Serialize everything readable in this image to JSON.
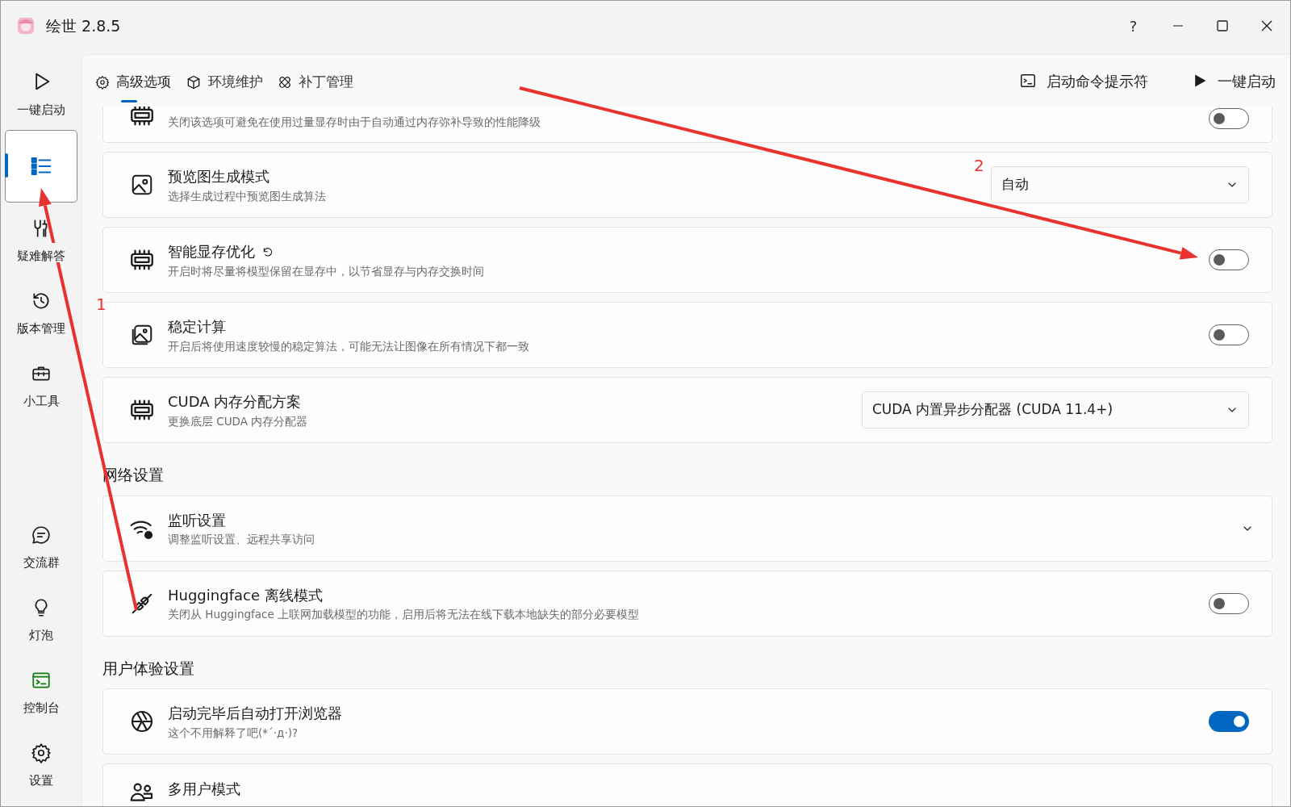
{
  "window": {
    "title": "绘世 2.8.5",
    "controls": [
      "?"
    ]
  },
  "sidebar": {
    "items": [
      {
        "label": "一键启动",
        "selected": false
      },
      {
        "selected": true
      },
      {
        "label": "疑难解答",
        "selected": false
      },
      {
        "label": "版本管理",
        "selected": false
      },
      {
        "label": "小工具",
        "selected": false
      }
    ],
    "bottom_items": [
      {
        "label": "交流群",
        "selected": false
      },
      {
        "label": "灯泡",
        "selected": false
      },
      {
        "label": "控制台",
        "selected": false
      },
      {
        "label": "设置",
        "selected": false
      }
    ]
  },
  "tabs": [
    {
      "label": "高级选项",
      "selected": true
    },
    {
      "label": "环境维护",
      "selected": false
    },
    {
      "label": "补丁管理",
      "selected": false
    }
  ],
  "actions": [
    "启动命令提示符",
    "一键启动"
  ],
  "sections": [
    {
      "rows": [
        {
          "kind": "toggle",
          "description": "关闭该选项可避免在使用过量显存时由于自动通过内存弥补导致的性能降级",
          "on": false
        },
        {
          "kind": "select",
          "title": "预览图生成模式",
          "description": "选择生成过程中预览图生成算法",
          "value": "自动"
        },
        {
          "kind": "toggle",
          "title": "智能显存优化",
          "description": "开启时将尽量将模型保留在显存中，以节省显存与内存交换时间",
          "on": false,
          "has_reset": true
        },
        {
          "kind": "toggle",
          "title": "稳定计算",
          "description": "开启后将使用速度较慢的稳定算法，可能无法让图像在所有情况下都一致",
          "on": false
        },
        {
          "kind": "select",
          "title": "CUDA 内存分配方案",
          "description": "更换底层 CUDA 内存分配器",
          "value": "CUDA 内置异步分配器 (CUDA 11.4+)"
        }
      ]
    },
    {
      "heading": "网络设置",
      "rows": [
        {
          "kind": "expander",
          "title": "监听设置",
          "description": "调整监听设置、远程共享访问"
        },
        {
          "kind": "toggle",
          "title": "Huggingface 离线模式",
          "description": "关闭从 Huggingface 上联网加载模型的功能，启用后将无法在线下载本地缺失的部分必要模型",
          "on": false
        }
      ]
    },
    {
      "heading": "用户体验设置",
      "rows": [
        {
          "kind": "toggle",
          "title": "启动完毕后自动打开浏览器",
          "description": "这个不用解释了吧(*´·д·)?",
          "on": true
        },
        {
          "kind": "none",
          "title": "多用户模式"
        }
      ]
    }
  ],
  "annotations": [
    {
      "label": "1"
    },
    {
      "label": "2"
    }
  ]
}
